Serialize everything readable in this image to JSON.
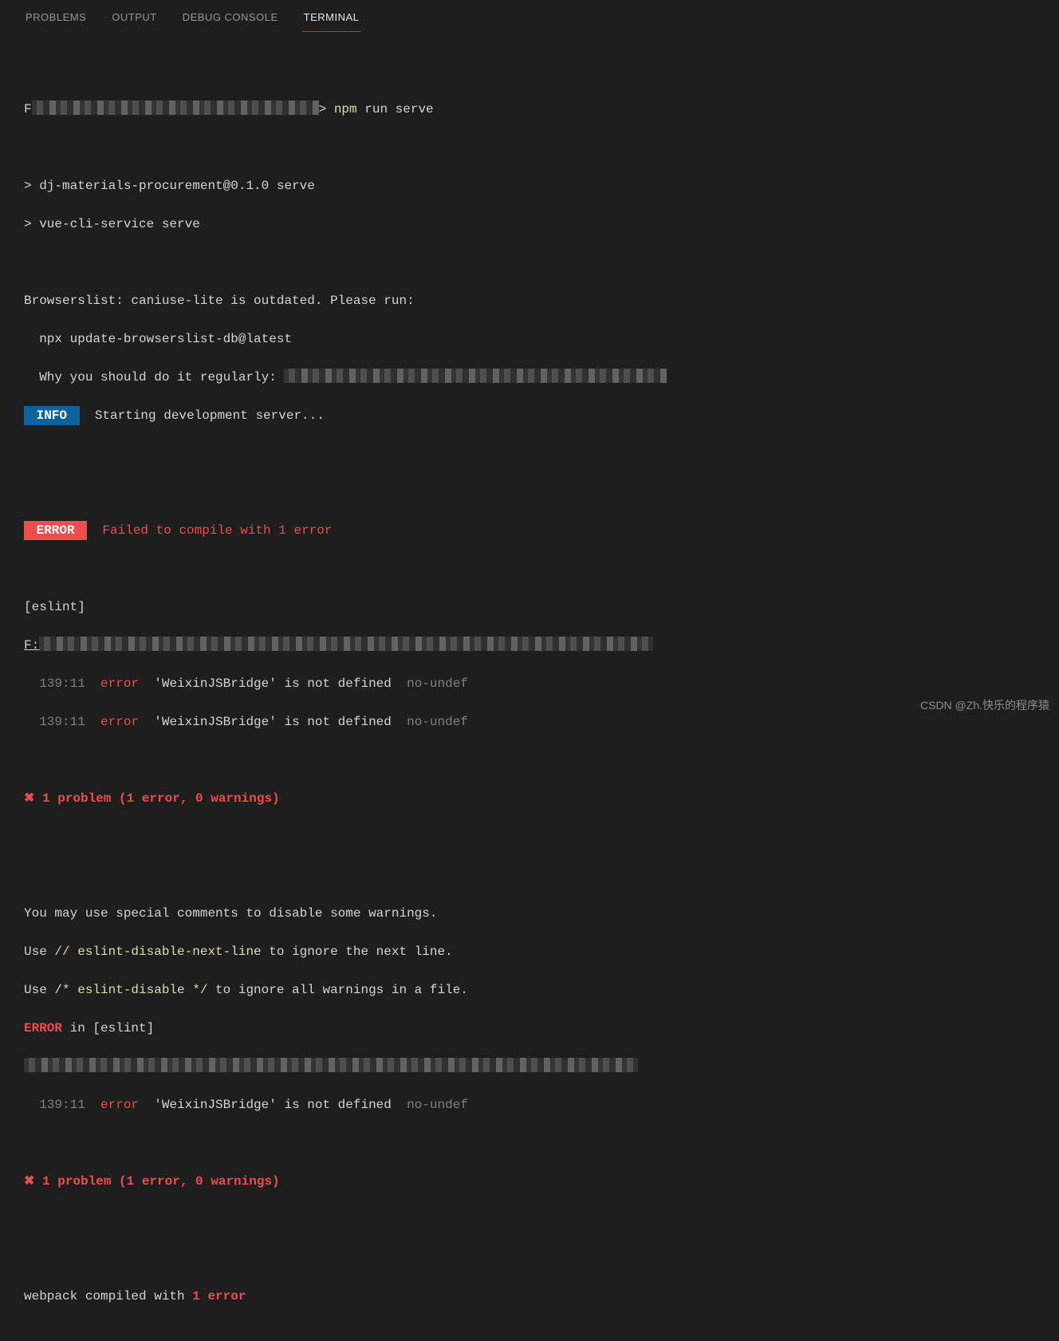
{
  "tabs": {
    "problems": "PROBLEMS",
    "output": "OUTPUT",
    "debug": "DEBUG CONSOLE",
    "terminal": "TERMINAL"
  },
  "term": {
    "prompt_suffix": ">",
    "cmd_npm": "npm",
    "cmd_rest": " run serve",
    "line_serve1": "> dj-materials-procurement@0.1.0 serve",
    "line_serve2": "> vue-cli-service serve",
    "browserslist": "Browserslist: caniuse-lite is outdated. Please run:",
    "npx": "  npx update-browserslist-db@latest",
    "why": "  Why you should do it regularly: ",
    "info_badge": " INFO ",
    "info_text": "  Starting development server...",
    "error_badge": " ERROR ",
    "error_text": "  Failed to compile with 1 error",
    "eslint_open": "[eslint]",
    "file_prefix": "F:",
    "lint_loc": "  139:11",
    "lint_sev": "error",
    "lint_msg": "'WeixinJSBridge' is not defined",
    "lint_rule": "no-undef",
    "x_icon": "✖",
    "problem_summary": " 1 problem (1 error, 0 warnings)",
    "hint1": "You may use special comments to disable some warnings.",
    "hint2a": "Use ",
    "hint2b": "// eslint-disable-next-line",
    "hint2c": " to ignore the next line.",
    "hint3a": "Use ",
    "hint3b": "/* eslint-disable */",
    "hint3c": " to ignore all warnings in a file.",
    "error_in": "ERROR",
    "error_in_rest": " in [eslint]",
    "webpack_a": "webpack compiled with ",
    "webpack_b": "1 error"
  },
  "watermark": "CSDN @Zh.快乐的程序猿"
}
